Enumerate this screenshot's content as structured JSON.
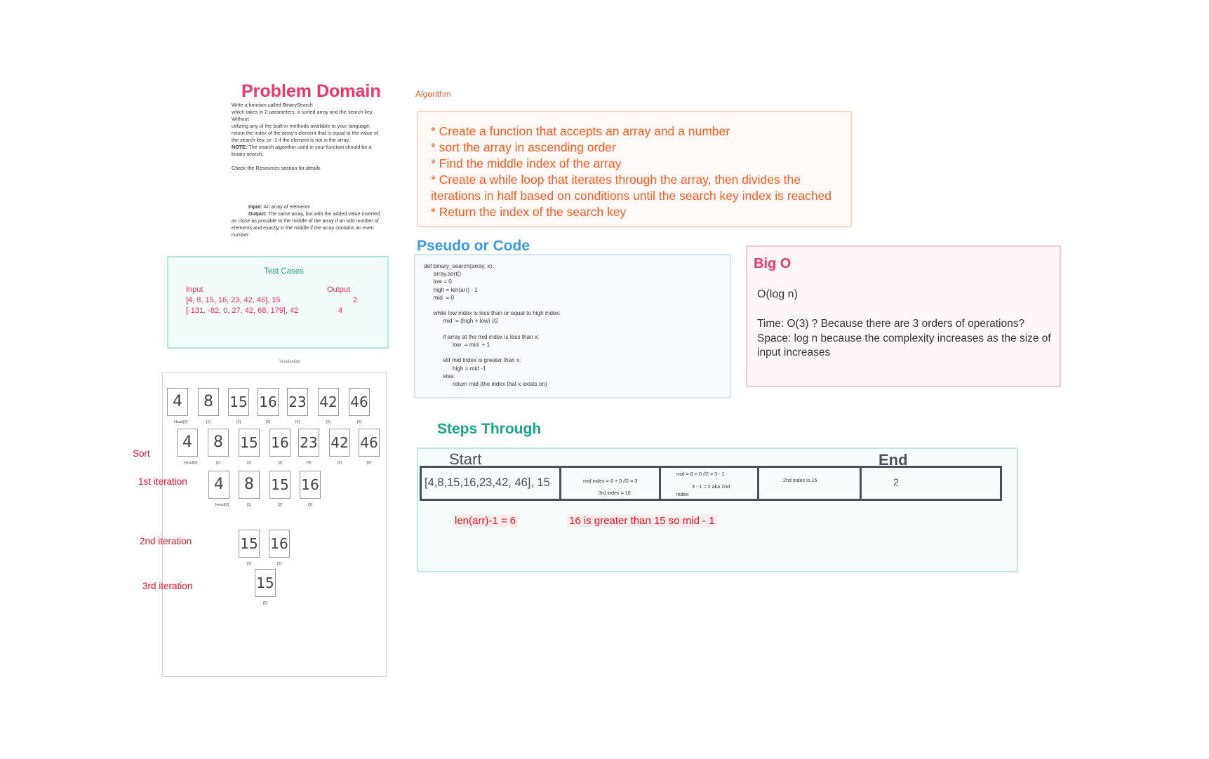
{
  "problem_domain": {
    "title": "Problem Domain",
    "description": [
      "Write a function called BinarySearch",
      " which takes in 2 parameters: a sorted array and the search key.",
      "Without",
      " utilizing any of the built-in methods available to your language,",
      "return the index of the array's element that is equal to the value of",
      "the search key, or -1 if the element is not in the array."
    ],
    "note_label": "NOTE:",
    "note_text": " The search algorithm used in your function should be a",
    "note_text2": "binary search.",
    "resources": "Check the Resources section for details",
    "input_label": "Input:",
    "input_text": " An array of elements",
    "output_label": "Output:",
    "output_text": " The same array, but with the added value inserted",
    "output_lines": [
      "as close as possible to the middle of the array if an odd number of",
      "elements and exactly in the middle if the array contains an even",
      "number"
    ]
  },
  "algorithm": {
    "label": "Algorithm",
    "lines": [
      "* Create a function that accepts an array and a number",
      "* sort the array in ascending order",
      "* Find the middle index of the array",
      "* Create  a while loop that iterates through the array, then divides the",
      "iterations in half based on conditions until the search key index is reached",
      "* Return the index of the search key"
    ]
  },
  "pseudo_code": {
    "title": "Pseudo or Code",
    "code": "def binary_search(array, x):\n      array.sort()\n      low = 0\n      high = len(arr) - 1\n      mid  = 0\n\n      while low index is less than or equal to high index:\n            mid  = (high + low) //2\n\n            if array at the mid index is less than x:\n                  low  = mid  + 1\n\n            elif mid index is greater than x:\n                  high = mid -1\n            else:\n                  return mid (the index that x exists on)"
  },
  "big_o": {
    "title": "Big O",
    "complexity": "O(log n)",
    "time": "Time: O(3) ? Because there are 3 orders of operations?",
    "space_line1": "Space: log n because the complexity increases as the size of",
    "space_line2": "input increases"
  },
  "test_cases": {
    "title": "Test Cases",
    "input_header": "Input",
    "output_header": "Output",
    "rows": [
      {
        "input": "[4, 8, 15, 16, 23, 42, 46], 15",
        "output": "2"
      },
      {
        "input": "[-131, -82, 0, 27, 42, 68, 179], 42",
        "output": "4"
      }
    ]
  },
  "visualization": {
    "label": "Visalization",
    "row0": {
      "digits": [
        "4",
        "8",
        "15",
        "16",
        "23",
        "42",
        "46"
      ],
      "indices": [
        "Head[0]",
        "[1]",
        "[2]",
        "[3]",
        "[4]",
        "[5]",
        "[6]"
      ]
    },
    "row1": {
      "digits": [
        "4",
        "8",
        "15",
        "16",
        "23",
        "42",
        "46"
      ],
      "indices": [
        "Head[0]",
        "[1]",
        "[2]",
        "[3]",
        "[4]",
        "[5]",
        "[6]"
      ]
    },
    "row2": {
      "digits": [
        "4",
        "8",
        "15",
        "16"
      ],
      "indices": [
        "Head[0]",
        "[1]",
        "[2]",
        "[3]"
      ]
    },
    "row3": {
      "digits": [
        "15",
        "16"
      ],
      "indices": [
        "[2]",
        "[3]"
      ]
    },
    "row4": {
      "digits": [
        "15"
      ],
      "indices": [
        "[2]"
      ]
    },
    "labels": {
      "sort": "Sort",
      "first": "1st iteration",
      "second": "2nd iteration",
      "third": "3rd iteration"
    }
  },
  "steps_through": {
    "title": "Steps Through",
    "start": "Start",
    "end": "End",
    "cell1": "[4,8,15,16,23,42, 46], 15",
    "cell2_line1": "mid index = 6 + 0 //2 =  3",
    "cell2_line2": "3rd index = 16",
    "cell3_line1": "mid  = 6 + 0 //2 =  3 - 1",
    "cell3_line2": "3 - 1 = 2 aka 2nd",
    "cell3_line3": "index",
    "cell4": "2nd index is 15",
    "cell5": "2",
    "note1": "len(arr)-1 = 6",
    "note2": "16 is greater than 15 so  mid - 1"
  }
}
